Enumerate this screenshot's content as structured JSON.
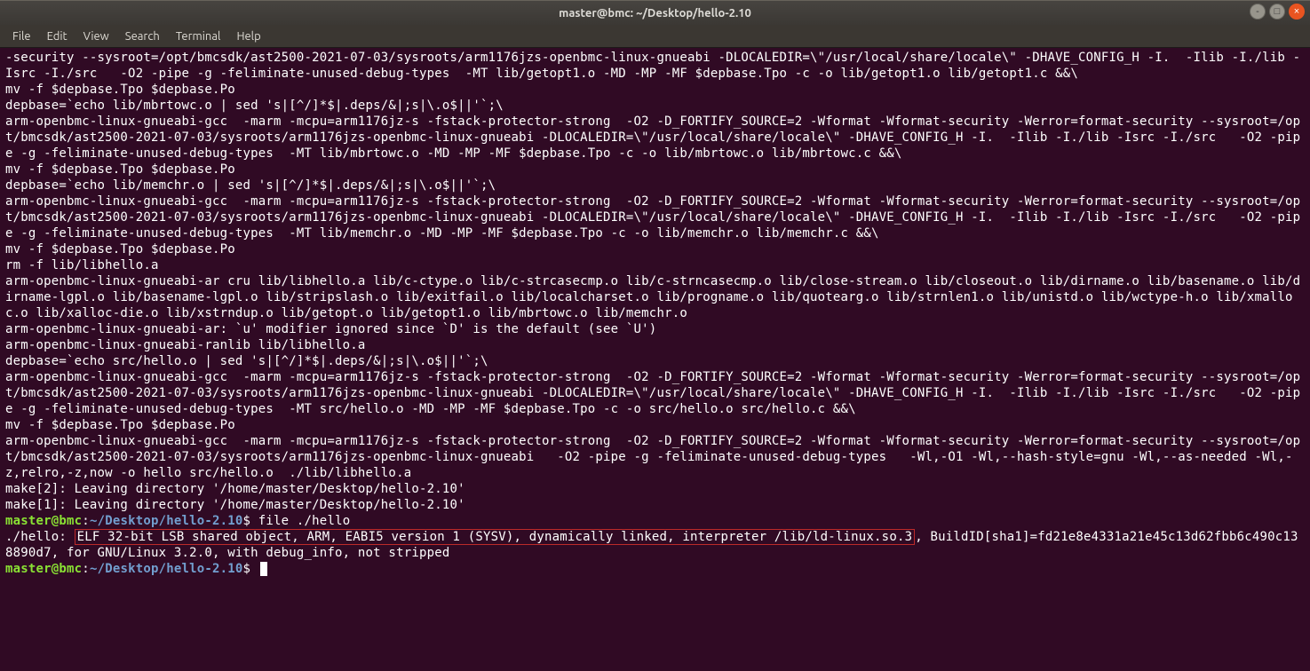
{
  "titlebar": {
    "title": "master@bmc: ~/Desktop/hello-2.10"
  },
  "menu": {
    "file": "File",
    "edit": "Edit",
    "view": "View",
    "search": "Search",
    "terminal": "Terminal",
    "help": "Help"
  },
  "term": {
    "l01": "-security --sysroot=/opt/bmcsdk/ast2500-2021-07-03/sysroots/arm1176jzs-openbmc-linux-gnueabi -DLOCALEDIR=\\\"/usr/local/share/locale\\\" -DHAVE_CONFIG_H -I.  -Ilib -I./lib -Isrc -I./src   -O2 -pipe -g -feliminate-unused-debug-types  -MT lib/getopt1.o -MD -MP -MF $depbase.Tpo -c -o lib/getopt1.o lib/getopt1.c &&\\",
    "l02": "mv -f $depbase.Tpo $depbase.Po",
    "l03": "depbase=`echo lib/mbrtowc.o | sed 's|[^/]*$|.deps/&|;s|\\.o$||'`;\\",
    "l04": "arm-openbmc-linux-gnueabi-gcc  -marm -mcpu=arm1176jz-s -fstack-protector-strong  -O2 -D_FORTIFY_SOURCE=2 -Wformat -Wformat-security -Werror=format-security --sysroot=/opt/bmcsdk/ast2500-2021-07-03/sysroots/arm1176jzs-openbmc-linux-gnueabi -DLOCALEDIR=\\\"/usr/local/share/locale\\\" -DHAVE_CONFIG_H -I.  -Ilib -I./lib -Isrc -I./src   -O2 -pipe -g -feliminate-unused-debug-types  -MT lib/mbrtowc.o -MD -MP -MF $depbase.Tpo -c -o lib/mbrtowc.o lib/mbrtowc.c &&\\",
    "l05": "mv -f $depbase.Tpo $depbase.Po",
    "l06": "depbase=`echo lib/memchr.o | sed 's|[^/]*$|.deps/&|;s|\\.o$||'`;\\",
    "l07": "arm-openbmc-linux-gnueabi-gcc  -marm -mcpu=arm1176jz-s -fstack-protector-strong  -O2 -D_FORTIFY_SOURCE=2 -Wformat -Wformat-security -Werror=format-security --sysroot=/opt/bmcsdk/ast2500-2021-07-03/sysroots/arm1176jzs-openbmc-linux-gnueabi -DLOCALEDIR=\\\"/usr/local/share/locale\\\" -DHAVE_CONFIG_H -I.  -Ilib -I./lib -Isrc -I./src   -O2 -pipe -g -feliminate-unused-debug-types  -MT lib/memchr.o -MD -MP -MF $depbase.Tpo -c -o lib/memchr.o lib/memchr.c &&\\",
    "l08": "mv -f $depbase.Tpo $depbase.Po",
    "l09": "rm -f lib/libhello.a",
    "l10": "arm-openbmc-linux-gnueabi-ar cru lib/libhello.a lib/c-ctype.o lib/c-strcasecmp.o lib/c-strncasecmp.o lib/close-stream.o lib/closeout.o lib/dirname.o lib/basename.o lib/dirname-lgpl.o lib/basename-lgpl.o lib/stripslash.o lib/exitfail.o lib/localcharset.o lib/progname.o lib/quotearg.o lib/strnlen1.o lib/unistd.o lib/wctype-h.o lib/xmalloc.o lib/xalloc-die.o lib/xstrndup.o lib/getopt.o lib/getopt1.o lib/mbrtowc.o lib/memchr.o",
    "l11": "arm-openbmc-linux-gnueabi-ar: `u' modifier ignored since `D' is the default (see `U')",
    "l12": "arm-openbmc-linux-gnueabi-ranlib lib/libhello.a",
    "l13": "depbase=`echo src/hello.o | sed 's|[^/]*$|.deps/&|;s|\\.o$||'`;\\",
    "l14": "arm-openbmc-linux-gnueabi-gcc  -marm -mcpu=arm1176jz-s -fstack-protector-strong  -O2 -D_FORTIFY_SOURCE=2 -Wformat -Wformat-security -Werror=format-security --sysroot=/opt/bmcsdk/ast2500-2021-07-03/sysroots/arm1176jzs-openbmc-linux-gnueabi -DLOCALEDIR=\\\"/usr/local/share/locale\\\" -DHAVE_CONFIG_H -I.  -Ilib -I./lib -Isrc -I./src   -O2 -pipe -g -feliminate-unused-debug-types  -MT src/hello.o -MD -MP -MF $depbase.Tpo -c -o src/hello.o src/hello.c &&\\",
    "l15": "mv -f $depbase.Tpo $depbase.Po",
    "l16": "arm-openbmc-linux-gnueabi-gcc  -marm -mcpu=arm1176jz-s -fstack-protector-strong  -O2 -D_FORTIFY_SOURCE=2 -Wformat -Wformat-security -Werror=format-security --sysroot=/opt/bmcsdk/ast2500-2021-07-03/sysroots/arm1176jzs-openbmc-linux-gnueabi   -O2 -pipe -g -feliminate-unused-debug-types   -Wl,-O1 -Wl,--hash-style=gnu -Wl,--as-needed -Wl,-z,relro,-z,now -o hello src/hello.o  ./lib/libhello.a",
    "l17": "make[2]: Leaving directory '/home/master/Desktop/hello-2.10'",
    "l18": "make[1]: Leaving directory '/home/master/Desktop/hello-2.10'",
    "prompt_user": "master@bmc",
    "prompt_colon": ":",
    "prompt_path": "~/Desktop/hello-2.10",
    "prompt_dollar": "$ ",
    "cmd1": "file ./hello",
    "file_out_pre": "./hello: ",
    "file_out_hl": "ELF 32-bit LSB shared object, ARM, EABI5 version 1 (SYSV), dynamically linked, interpreter /lib/ld-linux.so.3",
    "file_out_post": ", BuildID[sha1]=fd21e8e4331a21e45c13d62fbb6c490c138890d7, for GNU/Linux 3.2.0, with debug_info, not stripped"
  }
}
